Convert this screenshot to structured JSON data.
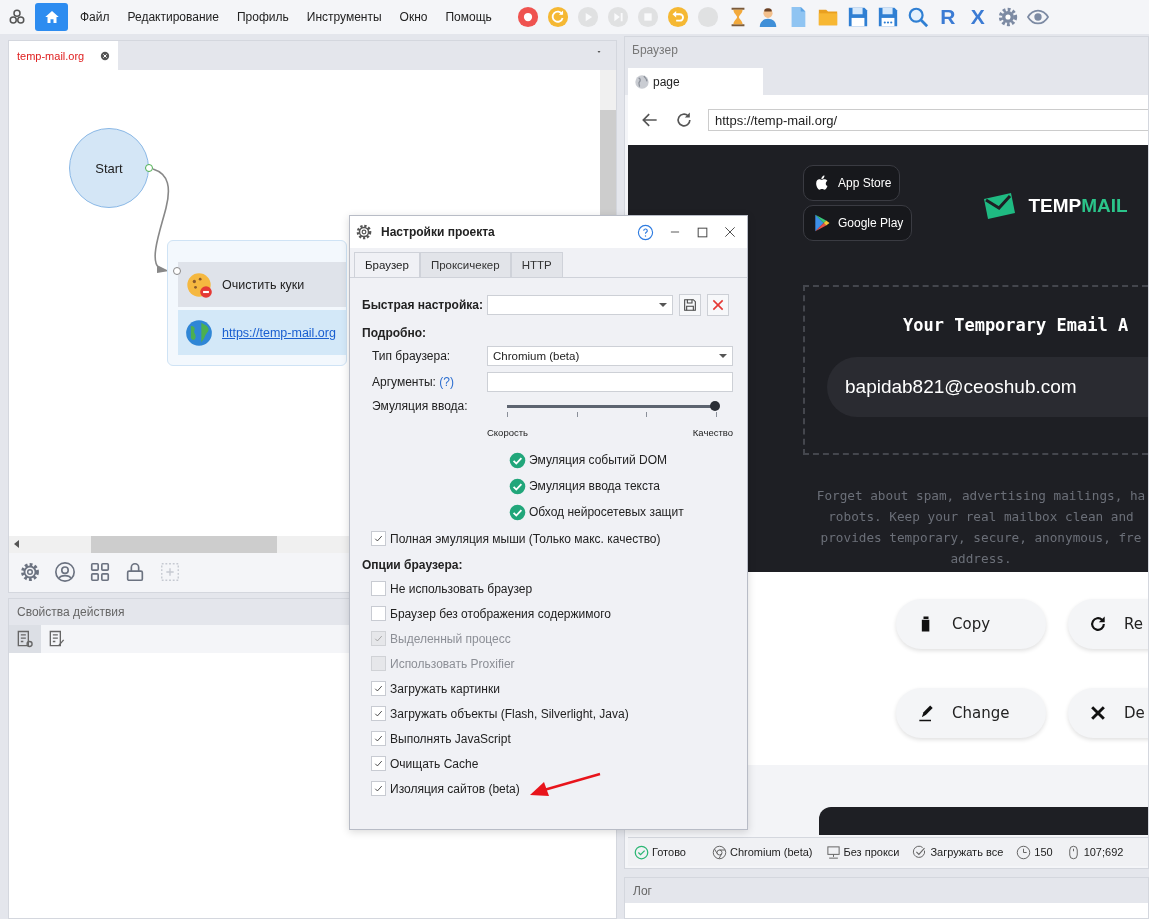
{
  "menu_bar": {
    "home_button": {
      "selected": true
    },
    "items": [
      "Файл",
      "Редактирование",
      "Профиль",
      "Инструменты",
      "Окно",
      "Помощь"
    ],
    "toolbar": [
      {
        "kind": "record",
        "disabled": false
      },
      {
        "kind": "restart",
        "disabled": false
      },
      {
        "kind": "play",
        "disabled": true
      },
      {
        "kind": "step",
        "disabled": true
      },
      {
        "kind": "stop",
        "disabled": true
      },
      {
        "kind": "undo",
        "disabled": false
      },
      {
        "kind": "blank",
        "disabled": true
      },
      {
        "kind": "hourglass",
        "disabled": false
      },
      {
        "kind": "person",
        "disabled": false
      },
      {
        "kind": "file",
        "disabled": false
      },
      {
        "kind": "folder",
        "disabled": false
      },
      {
        "kind": "save",
        "disabled": false
      },
      {
        "kind": "save-as",
        "disabled": false
      },
      {
        "kind": "search",
        "disabled": false
      },
      {
        "kind": "letter",
        "text": "R",
        "disabled": false
      },
      {
        "kind": "letter",
        "text": "X",
        "disabled": false
      },
      {
        "kind": "settings",
        "disabled": false
      },
      {
        "kind": "eye",
        "disabled": false
      }
    ]
  },
  "project": {
    "tabs": [
      {
        "label": "temp-mail.org",
        "selected": true
      }
    ],
    "start_node": {
      "label": "Start"
    },
    "action_group": [
      {
        "kind": "cookie",
        "label": "Очистить куки",
        "selected": false
      },
      {
        "kind": "link",
        "label": "https://temp-mail.org",
        "selected": true
      }
    ],
    "toolbar": [
      {
        "kind": "settings",
        "disabled": false
      },
      {
        "kind": "user",
        "disabled": false
      },
      {
        "kind": "grid",
        "disabled": false
      },
      {
        "kind": "lock",
        "disabled": false
      },
      {
        "kind": "add",
        "disabled": true
      }
    ]
  },
  "properties_panel": {
    "title": "Свойства действия",
    "tabs": [
      {
        "selected": true
      },
      {
        "selected": false
      }
    ]
  },
  "browser_panel": {
    "title": "Браузер",
    "tabs": [
      {
        "label": "page",
        "selected": true
      }
    ],
    "url": "https://temp-mail.org/",
    "page": {
      "store_buttons": [
        {
          "kind": "apple",
          "label": "App Store"
        },
        {
          "kind": "google",
          "label": "Google Play"
        }
      ],
      "logo": [
        {
          "text": "TEMP",
          "color": "#ffffff"
        },
        {
          "text": "MAIL",
          "color": "#2bc48a"
        }
      ],
      "heading": "Your Temporary Email A",
      "email": "bapidab821@ceoshub.com",
      "description": [
        "Forget about spam, advertising mailings, ha",
        "robots. Keep your real mailbox clean and",
        "provides temporary, secure, anonymous, fre",
        "address."
      ],
      "actions": [
        {
          "kind": "copy",
          "label": "Copy"
        },
        {
          "kind": "refresh",
          "label": "Re"
        },
        {
          "kind": "change",
          "label": "Change"
        },
        {
          "kind": "delete",
          "label": "De"
        }
      ]
    },
    "status_bar": [
      {
        "kind": "ready",
        "text": "Готово"
      },
      {
        "kind": "browser",
        "text": "Chromium (beta)"
      },
      {
        "kind": "proxy",
        "text": "Без прокси"
      },
      {
        "kind": "load",
        "text": "Загружать все"
      },
      {
        "kind": "timer",
        "text": "150"
      },
      {
        "kind": "mouse",
        "text": "107;692"
      }
    ]
  },
  "log_panel": {
    "title": "Лог"
  },
  "dialog": {
    "title": "Настройки проекта",
    "tabs": [
      {
        "label": "Браузер",
        "selected": true
      },
      {
        "label": "Проксичекер",
        "selected": false
      },
      {
        "label": "HTTP",
        "selected": false
      }
    ],
    "quick_setup": {
      "label": "Быстрая настройка:"
    },
    "details_title": "Подробно:",
    "browser_type": {
      "label": "Тип браузера:",
      "value": "Chromium (beta)"
    },
    "arguments": {
      "label": "Аргументы:",
      "help": "(?)"
    },
    "input_emulation": {
      "label": "Эмуляция ввода:",
      "level": 1,
      "min_label": "Скорость",
      "max_label": "Качество"
    },
    "features": [
      {
        "label": "Эмуляция событий DOM",
        "checked": true
      },
      {
        "label": "Эмуляция ввода текста",
        "checked": true
      },
      {
        "label": "Обход нейросетевых защит",
        "checked": true
      }
    ],
    "full_mouse": {
      "label": "Полная эмуляция мыши (Только макс. качество)",
      "checked": true
    },
    "options_title": "Опции браузера:",
    "options": [
      {
        "label": "Не использовать браузер",
        "checked": false,
        "disabled": false
      },
      {
        "label": "Браузер без отображения содержимого",
        "checked": false,
        "disabled": false
      },
      {
        "label": "Выделенный процесс",
        "checked": true,
        "disabled": true
      },
      {
        "label": "Использовать Proxifier",
        "checked": false,
        "disabled": true
      },
      {
        "label": "Загружать картинки",
        "checked": true,
        "disabled": false
      },
      {
        "label": "Загружать объекты (Flash, Silverlight, Java)",
        "checked": true,
        "disabled": false
      },
      {
        "label": "Выполнять JavaScript",
        "checked": true,
        "disabled": false
      },
      {
        "label": "Очищать Cache",
        "checked": true,
        "disabled": false
      },
      {
        "label": "Изоляция сайтов (beta)",
        "checked": true,
        "disabled": false
      }
    ],
    "annotations": [
      {
        "kind": "arrow"
      }
    ]
  }
}
